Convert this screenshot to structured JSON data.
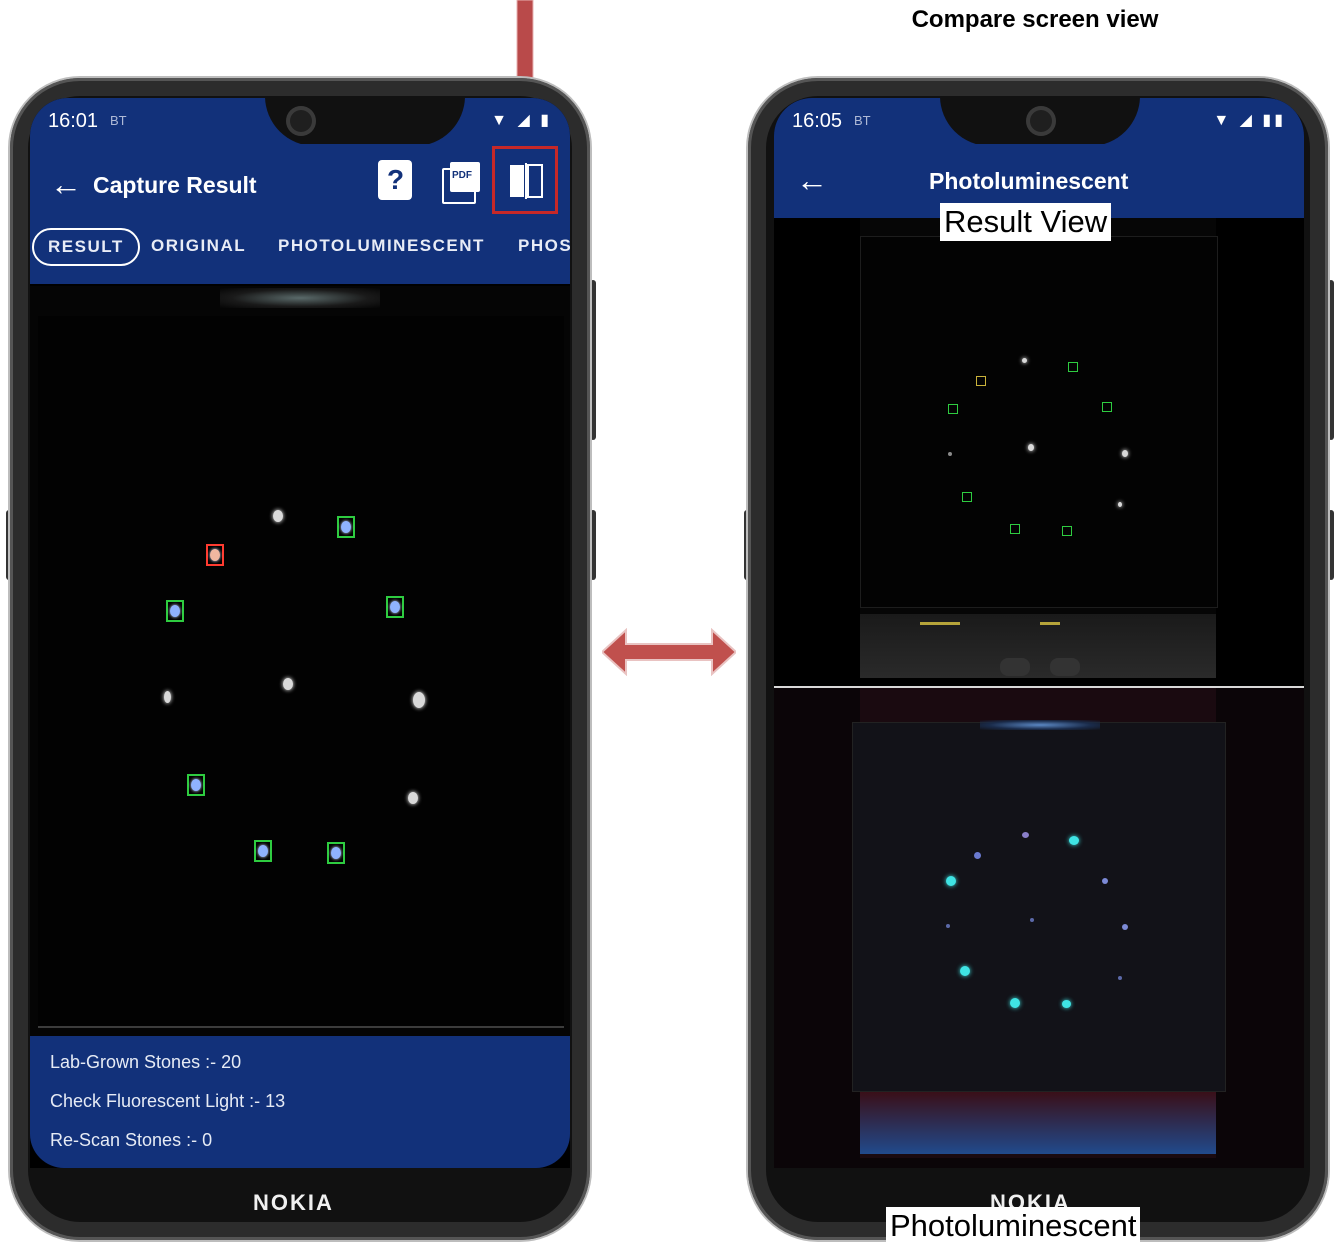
{
  "caption": "Compare screen view",
  "left_phone": {
    "status": {
      "time": "16:01",
      "bt": "BT"
    },
    "appbar": {
      "title": "Capture Result"
    },
    "tabs": [
      "RESULT",
      "ORIGINAL",
      "PHOTOLUMINESCENT",
      "PHOS"
    ],
    "summary": [
      "Lab-Grown Stones :- 20",
      "Check Fluorescent Light :- 13",
      "Re-Scan Stones :- 0"
    ],
    "brand": "NOKIA",
    "icons": {
      "help": "?",
      "pdf": "PDF"
    }
  },
  "right_phone": {
    "status": {
      "time": "16:05",
      "bt": "BT"
    },
    "appbar": {
      "title": "Photoluminescent"
    },
    "label_top": "Result View",
    "label_bottom": "Photoluminescent",
    "brand": "NOKIA"
  },
  "colors": {
    "appbar": "#12317a",
    "highlight": "#c62828",
    "arrow": "#b94a4a"
  },
  "icon_names": [
    "back-arrow-icon",
    "help-icon",
    "pdf-icon",
    "compare-icon",
    "down-arrow-icon",
    "double-arrow-icon"
  ]
}
